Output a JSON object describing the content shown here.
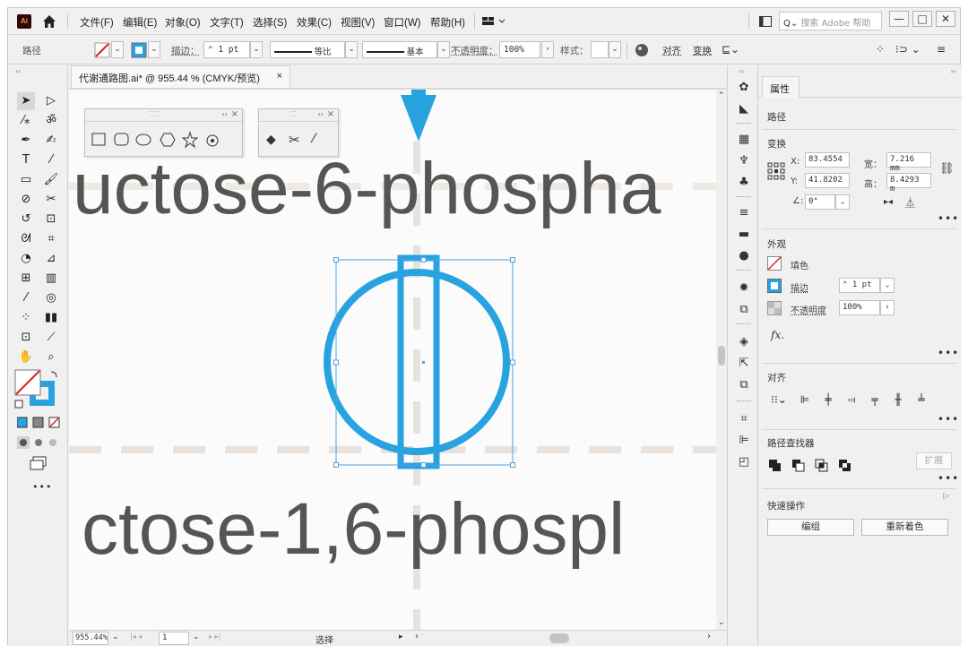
{
  "app": {
    "logo_text": "Ai",
    "menu": [
      "文件(F)",
      "编辑(E)",
      "对象(O)",
      "文字(T)",
      "选择(S)",
      "效果(C)",
      "视图(V)",
      "窗口(W)",
      "帮助(H)"
    ],
    "search_placeholder": "搜索 Adobe 帮助",
    "window_buttons": [
      "—",
      "□",
      "✕"
    ]
  },
  "control_bar": {
    "selection_label": "路径",
    "stroke_label": "描边：",
    "stroke_weight": "1 pt",
    "profile_label": "等比",
    "brush_label": "基本",
    "opacity_label": "不透明度：",
    "opacity_value": "100%",
    "style_label": "样式：",
    "align_label": "对齐",
    "transform_label": "变换"
  },
  "document": {
    "tab_title": "代谢通路图.ai* @ 955.44 % (CMYK/预览)",
    "close": "×",
    "canvas_text_top": "uctose-6-phospha",
    "canvas_text_bottom": "ctose-1,6-phospl"
  },
  "status_bar": {
    "zoom": "955.44%",
    "artboard": "1",
    "tool_status": "选择"
  },
  "properties": {
    "tab": "属性",
    "selection_type": "路径",
    "transform": {
      "title": "变换",
      "x_label": "X:",
      "x": "83.4554",
      "y_label": "Y:",
      "y": "41.8202",
      "w_label": "宽：",
      "w": "7.216 mm",
      "h_label": "高：",
      "h": "8.4293 m",
      "angle": "0°"
    },
    "appearance": {
      "title": "外观",
      "fill_label": "填色",
      "stroke_label": "描边",
      "stroke_weight": "1 pt",
      "opacity_label": "不透明度",
      "opacity": "100%",
      "fx_label": "fx."
    },
    "align": {
      "title": "对齐"
    },
    "pathfinder": {
      "title": "路径查找器",
      "expand_label": "扩展"
    },
    "quick_actions": {
      "title": "快速操作",
      "group_button": "编组",
      "recolor_button": "重新着色"
    },
    "more": "•••"
  },
  "toolbar": {
    "more": "•••"
  },
  "colors": {
    "accent": "#29a3e0",
    "selection": "#4aa3e6",
    "canvas_text": "#555555",
    "guide": "#e9e1db"
  }
}
